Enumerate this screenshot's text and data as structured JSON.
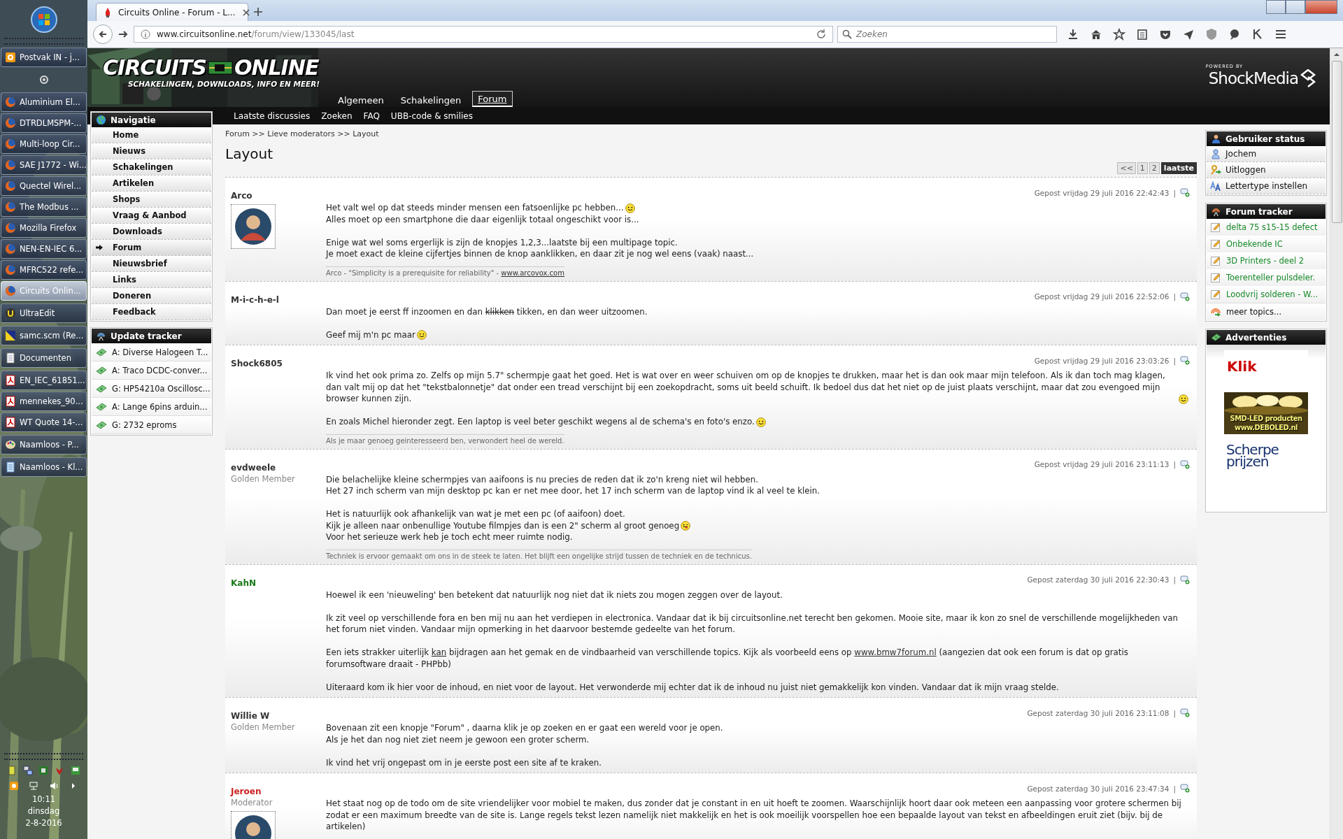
{
  "taskbar": {
    "groups": [
      {
        "items": [
          {
            "kind": "mail",
            "label": "Postvak IN - j...",
            "selected": false
          }
        ]
      },
      {
        "items": [
          {
            "kind": "pinned"
          }
        ]
      },
      {
        "items": [
          {
            "kind": "browser",
            "label": "Aluminium El...",
            "selected": false
          },
          {
            "kind": "browser",
            "label": "DTRDLMSPM-...",
            "selected": false
          },
          {
            "kind": "browser",
            "label": "Multi-loop Cir...",
            "selected": false
          },
          {
            "kind": "browser",
            "label": "SAE J1772 - Wi...",
            "selected": false
          },
          {
            "kind": "browser",
            "label": "Quectel Wirel...",
            "selected": false
          },
          {
            "kind": "browser",
            "label": "The Modbus ...",
            "selected": false
          },
          {
            "kind": "browser",
            "label": "Mozilla Firefox",
            "selected": false
          },
          {
            "kind": "browser",
            "label": "NEN-EN-IEC 6...",
            "selected": false
          },
          {
            "kind": "browser",
            "label": "MFRC522 refe...",
            "selected": false
          },
          {
            "kind": "browser",
            "label": "Circuits Onlin...",
            "selected": true
          }
        ]
      },
      {
        "items": [
          {
            "kind": "editor",
            "label": "UltraEdit",
            "selected": false
          }
        ]
      },
      {
        "items": [
          {
            "kind": "triangle",
            "label": "samc.scm (Re...",
            "selected": false
          }
        ]
      },
      {
        "items": [
          {
            "kind": "document",
            "label": "Documenten",
            "selected": false
          }
        ]
      },
      {
        "items": [
          {
            "kind": "pdf",
            "label": "EN_IEC_61851...",
            "selected": false
          },
          {
            "kind": "pdf",
            "label": "mennekes_90...",
            "selected": false
          },
          {
            "kind": "pdf",
            "label": "WT Quote 14-...",
            "selected": false
          }
        ]
      },
      {
        "items": [
          {
            "kind": "palette",
            "label": "Naamloos - P...",
            "selected": false
          }
        ]
      },
      {
        "items": [
          {
            "kind": "notepad",
            "label": "Naamloos - Kl...",
            "selected": false
          }
        ]
      }
    ],
    "clock": {
      "time": "10:11",
      "day": "dinsdag",
      "date": "2-8-2016"
    }
  },
  "browser": {
    "tab": {
      "title": "Circuits Online - Forum - L..."
    },
    "url": {
      "domain": "www.circuitsonline.net",
      "path": "/forum/view/133045/last"
    },
    "search": {
      "placeholder": "Zoeken"
    }
  },
  "site": {
    "logo": {
      "word1": "CIRCUITS",
      "word2": "ONLINE",
      "tagline": "SCHAKELINGEN, DOWNLOADS, INFO EN MEER!"
    },
    "powered_by": {
      "label": "POWERED BY",
      "name": "ShockMedia"
    },
    "main_nav": [
      {
        "label": "Algemeen",
        "selected": false
      },
      {
        "label": "Schakelingen",
        "selected": false
      },
      {
        "label": "Forum",
        "selected": true
      }
    ],
    "sub_nav": [
      "Laatste discussies",
      "Zoeken",
      "FAQ",
      "UBB-code & smilies"
    ]
  },
  "navigation": {
    "title": "Navigatie",
    "items": [
      {
        "label": "Home",
        "selected": false
      },
      {
        "label": "Nieuws",
        "selected": false
      },
      {
        "label": "Schakelingen",
        "selected": false
      },
      {
        "label": "Artikelen",
        "selected": false
      },
      {
        "label": "Shops",
        "selected": false
      },
      {
        "label": "Vraag & Aanbod",
        "selected": false
      },
      {
        "label": "Downloads",
        "selected": false
      },
      {
        "label": "Forum",
        "selected": true
      },
      {
        "label": "Nieuwsbrief",
        "selected": false
      },
      {
        "label": "Links",
        "selected": false
      },
      {
        "label": "Doneren",
        "selected": false
      },
      {
        "label": "Feedback",
        "selected": false
      }
    ]
  },
  "update_tracker": {
    "title": "Update tracker",
    "items": [
      "A: Diverse Halogeen T...",
      "A: Traco DCDC-conver...",
      "G: HP54210a Oscillosc...",
      "A: Lange 6pins arduin...",
      "G: 2732 eproms"
    ]
  },
  "breadcrumb": "Forum >> Lieve moderators >> Layout",
  "title": "Layout",
  "pagination": [
    {
      "label": "<<",
      "selected": false
    },
    {
      "label": "1",
      "selected": false
    },
    {
      "label": "2",
      "selected": false
    },
    {
      "label": "laatste",
      "selected": true
    }
  ],
  "posts": [
    {
      "user": "Arco",
      "color": "#333333",
      "avatar": true,
      "date": "Gepost vrijdag 29 juli 2016 22:42:43",
      "separator": "|",
      "paragraphs": [
        [
          [
            "Het valt wel op dat steeds minder mensen een fatsoenlijke pc hebben... ",
            {
              "kind": "smiley"
            }
          ],
          [
            "Alles moet op een smartphone die daar eigenlijk totaal ongeschikt voor is..."
          ]
        ],
        [
          [
            "Enige wat wel soms ergerlijk is zijn de knopjes 1,2,3...laatste bij een multipage topic."
          ],
          [
            "Je moet exact de kleine cijfertjes binnen de knop aanklikken, en daar zit je nog wel eens (vaak) naast..."
          ]
        ]
      ],
      "signature": [
        "Arco - \"Simplicity is a prerequisite for reliability\" - ",
        {
          "kind": "link",
          "text": "www.arcovox.com"
        }
      ]
    },
    {
      "user": "M-i-c-h-e-l",
      "color": "#333333",
      "avatar": false,
      "date": "Gepost vrijdag 29 juli 2016 22:52:06",
      "separator": "|",
      "paragraphs": [
        [
          [
            "Dan moet je eerst ff inzoomen en dan ",
            {
              "kind": "strike",
              "text": "klikken"
            },
            " tikken, en dan weer uitzoomen."
          ]
        ],
        [
          [
            "Geef mij m'n pc maar ",
            {
              "kind": "smiley"
            }
          ]
        ]
      ]
    },
    {
      "user": "Shock6805",
      "color": "#333333",
      "avatar": false,
      "date": "Gepost vrijdag 29 juli 2016 23:03:26",
      "separator": "|",
      "paragraphs": [
        [
          [
            "Ik vind het ook prima zo. Zelfs op mijn 5.7\" schermpje gaat het goed. Het is wat over en weer schuiven om op de knopjes te drukken, maar het is dan ook maar mijn telefoon. Als ik dan toch mag klagen, dan valt mij op dat het \"tekstbalonnetje\" dat onder een tread verschijnt bij een zoekopdracht, soms uit beeld schuift. Ik bedoel dus dat het niet op de juist plaats verschijnt, maar dat zou evengoed mijn browser kunnen zijn. ",
            {
              "kind": "smiley"
            }
          ]
        ],
        [
          [
            "En zoals Michel hieronder zegt. Een laptop is veel beter geschikt wegens al de schema's en foto's enzo. ",
            {
              "kind": "smiley"
            }
          ]
        ]
      ],
      "signature": [
        "Als je maar genoeg geinteresseerd ben, verwondert heel de wereld."
      ]
    },
    {
      "user": "evdweele",
      "rank": "Golden Member",
      "color": "#333333",
      "avatar": false,
      "date": "Gepost vrijdag 29 juli 2016 23:11:13",
      "separator": "|",
      "paragraphs": [
        [
          [
            "Die belachelijke kleine schermpjes van aaifoons is nu precies de reden dat ik zo'n kreng niet wil hebben."
          ],
          [
            "Het 27 inch scherm van mijn desktop pc kan er net mee door, het 17 inch scherm van de laptop vind ik al veel te klein."
          ]
        ],
        [
          [
            "Het is natuurlijk ook afhankelijk van wat je met een pc (of aaifoon) doet."
          ],
          [
            "Kijk je alleen naar onbenullige Youtube filmpjes dan is een 2\" scherm al groot genoeg ",
            {
              "kind": "tongue"
            }
          ],
          [
            "Voor het serieuze werk heb je toch echt meer ruimte nodig."
          ]
        ]
      ],
      "signature": [
        "Techniek is ervoor gemaakt om ons in de steek te laten. Het blijft een ongelijke strijd tussen de techniek en de technicus."
      ]
    },
    {
      "user": "KahN",
      "color": "#1a7a1a",
      "avatar": false,
      "date": "Gepost zaterdag 30 juli 2016 22:30:43",
      "separator": "|",
      "paragraphs": [
        [
          [
            "Hoewel ik een 'nieuweling' ben betekent dat natuurlijk nog niet dat ik niets zou mogen zeggen over de layout."
          ]
        ],
        [
          [
            "Ik zit veel op verschillende fora en ben mij nu aan het verdiepen in electronica. Vandaar dat ik bij circuitsonline.net terecht ben gekomen. Mooie site, maar ik kon zo snel de verschillende mogelijkheden van het forum niet vinden. Vandaar mijn opmerking in het daarvoor bestemde gedeelte van het forum."
          ]
        ],
        [
          [
            "Een iets strakker uiterlijk ",
            {
              "kind": "underline",
              "text": "kan"
            },
            " bijdragen aan het gemak en de vindbaarheid van verschillende topics. Kijk als voorbeeld eens op ",
            {
              "kind": "link",
              "text": "www.bmw7forum.nl"
            },
            " (aangezien dat ook een forum is dat op gratis forumsoftware draait - PHPbb)"
          ]
        ],
        [
          [
            "Uiteraard kom ik hier voor de inhoud, en niet voor de layout. Het verwonderde mij echter dat ik de inhoud nu juist niet gemakkelijk kon vinden. Vandaar dat ik mijn vraag stelde."
          ]
        ]
      ]
    },
    {
      "user": "Willie W",
      "rank": "Golden Member",
      "color": "#333333",
      "avatar": false,
      "date": "Gepost zaterdag 30 juli 2016 23:11:08",
      "separator": "|",
      "paragraphs": [
        [
          [
            "Bovenaan zit een knopje \"Forum\" , daarna klik je op zoeken en er gaat een wereld voor je open."
          ],
          [
            "Als je het dan nog niet ziet neem je gewoon een groter scherm."
          ]
        ],
        [
          [
            "Ik vind het vrij ongepast om in je eerste post een site af te kraken."
          ]
        ]
      ]
    },
    {
      "user": "Jeroen",
      "rank": "Moderator",
      "color": "#cc2222",
      "avatar": true,
      "date": "Gepost zaterdag 30 juli 2016 23:47:34",
      "separator": "|",
      "paragraphs": [
        [
          [
            "Het staat nog op de todo om de site vriendelijker voor mobiel te maken, dus zonder dat je constant in en uit hoeft te zoomen. Waarschijnlijk hoort daar ook meteen een aanpassing voor grotere schermen bij zodat er een maximum breedte van de site is. Lange regels tekst lezen namelijk niet makkelijk en het is ook moeilijk voorspellen hoe een bepaalde layout van tekst en afbeeldingen eruit ziet (bijv. bij de artikelen)"
          ]
        ]
      ]
    }
  ],
  "user_status": {
    "title": "Gebruiker status",
    "items": [
      {
        "kind": "user",
        "label": "Jochem"
      },
      {
        "kind": "keys",
        "label": "Uitloggen"
      },
      {
        "kind": "font",
        "label": "Lettertype instellen"
      }
    ]
  },
  "forum_tracker": {
    "title": "Forum tracker",
    "items": [
      {
        "kind": "topic",
        "label": "delta 75 s15-15 defect"
      },
      {
        "kind": "topic",
        "label": "Onbekende IC"
      },
      {
        "kind": "topic",
        "label": "3D Printers - deel 2"
      },
      {
        "kind": "topic",
        "label": "Toerenteller pulsdeler."
      },
      {
        "kind": "topic",
        "label": "Loodvrij solderen - W..."
      },
      {
        "kind": "more",
        "label": "meer topics..."
      }
    ]
  },
  "ads": {
    "title": "Advertenties",
    "items": [
      {
        "kind": "word",
        "lines": [
          "Klik"
        ]
      },
      {
        "kind": "banner",
        "lines": [
          "SMD-LED producten",
          "www.DEBOLED.nl"
        ]
      },
      {
        "kind": "logo",
        "lines": [
          "Scherpe",
          "prijzen"
        ]
      }
    ]
  }
}
